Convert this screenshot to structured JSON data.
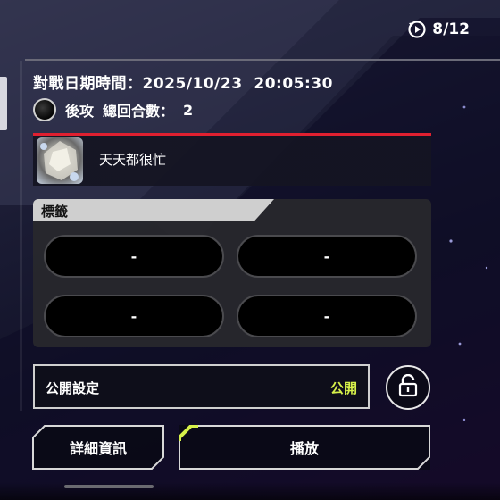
{
  "header": {
    "page_counter": "8/12",
    "counter_icon": "replay-icon"
  },
  "match": {
    "datetime_label": "對戰日期時間：",
    "datetime_value": "2025/10/23  20:05:30",
    "turn_order": "後攻",
    "total_turns_label": "總回合數：",
    "total_turns_value": "2",
    "coin_icon": "coin-icon"
  },
  "player": {
    "name": "天天都很忙",
    "avatar_icon": "avatar-image"
  },
  "tags": {
    "header": "標籤",
    "slots": [
      "-",
      "-",
      "-",
      "-"
    ]
  },
  "visibility": {
    "label": "公開設定",
    "value": "公開",
    "lock_icon": "lock-icon"
  },
  "actions": {
    "details_label": "詳細資訊",
    "play_label": "播放"
  },
  "colors": {
    "accent_green": "#d6f04a",
    "divider_red": "#e02030"
  }
}
